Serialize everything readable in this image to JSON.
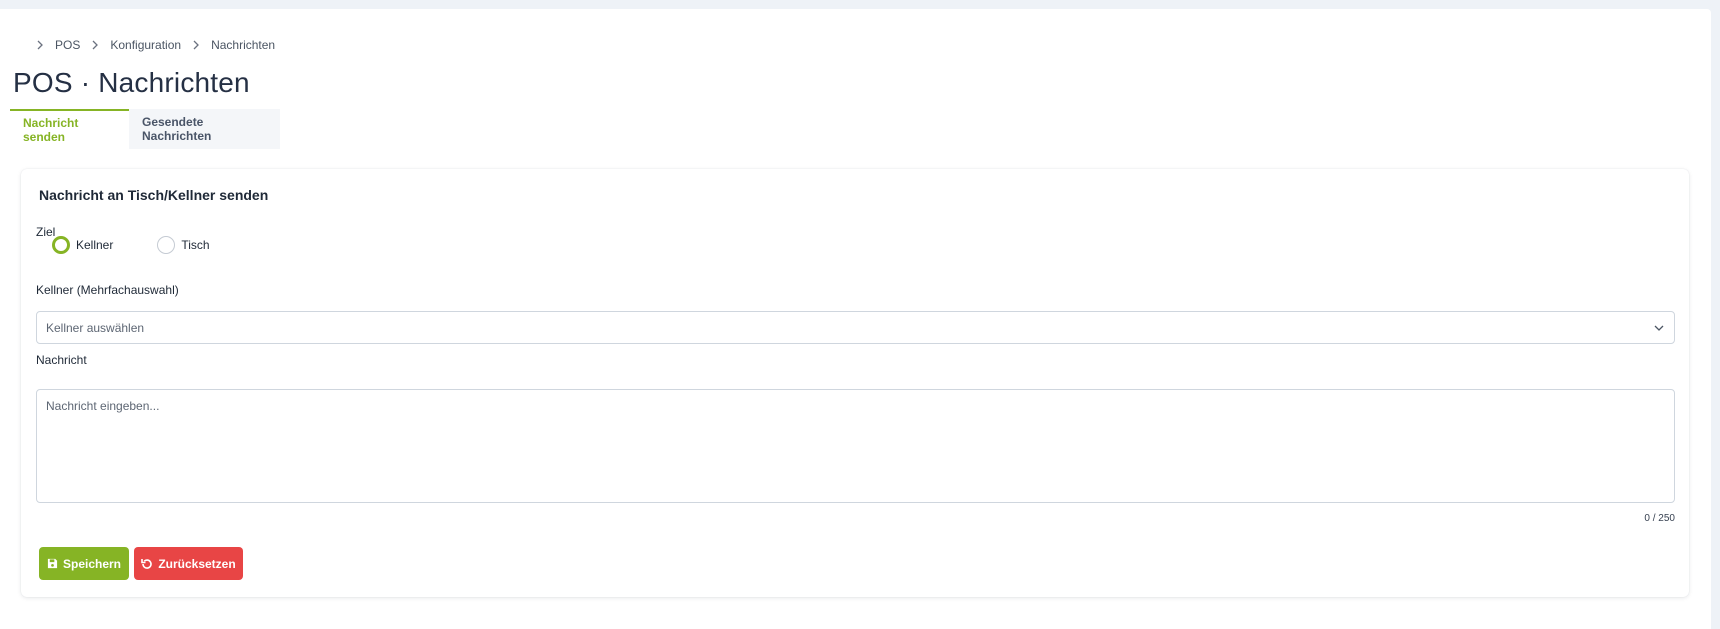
{
  "breadcrumb": [
    "POS",
    "Konfiguration",
    "Nachrichten"
  ],
  "page_title": "POS · Nachrichten",
  "tabs": [
    {
      "label": "Nachricht senden",
      "active": true
    },
    {
      "label": "Gesendete Nachrichten",
      "active": false
    }
  ],
  "form": {
    "title": "Nachricht an Tisch/Kellner senden",
    "target_label": "Ziel",
    "target_options": [
      {
        "label": "Kellner",
        "checked": true
      },
      {
        "label": "Tisch",
        "checked": false
      }
    ],
    "waiter_label": "Kellner (Mehrfachauswahl)",
    "waiter_placeholder": "Kellner auswählen",
    "message_label": "Nachricht",
    "message_placeholder": "Nachricht eingeben...",
    "message_value": "",
    "counter": "0 / 250",
    "save_label": "Speichern",
    "reset_label": "Zurücksetzen"
  },
  "colors": {
    "accent": "#86b425",
    "danger": "#e84545",
    "background": "#eef2f7"
  },
  "icons": {
    "breadcrumb_separator": "chevron-right-icon",
    "select_toggle": "chevron-down-icon",
    "save": "floppy-disk-icon",
    "reset": "undo-icon"
  }
}
